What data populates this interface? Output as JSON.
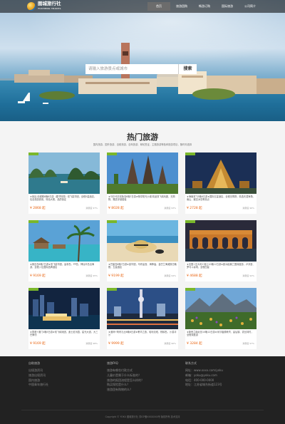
{
  "brand": {
    "name": "图城旅行社",
    "sub": "TUCHENG TRAVEL"
  },
  "nav": {
    "items": [
      "首页",
      "旅游团购",
      "畅游订购",
      "国际旅游",
      "公司简介"
    ]
  },
  "search": {
    "placeholder": "请输入旅游景点或城市",
    "button": "搜索"
  },
  "section": {
    "title": "热门旅游",
    "subtitle": "国内旅游、国外旅游、自助旅游、自驾旅游、邮轮签证、主题旅游等各种旅游项目，随时你选择"
  },
  "cards": [
    {
      "desc": "★曼谷-芭堤雅6晚8日游（春节特惠）双飞豪华团，全程5星酒店，包含旅游费用，特色大餐，品质保证",
      "price": "¥ 2868 起",
      "rate": "满意度 97%"
    },
    {
      "desc": "★马尔代夫双鱼岛6晚7日游★畅享阳光沙滩 精品双飞纯玩团，无购物，赠送浮潜套装",
      "price": "¥ 8028 起",
      "rate": "满意度 93%"
    },
    {
      "desc": "★海南双飞5晚6日游★国际五星酒店，全程无购物，精选天涯海角、南山、蜈支洲岛等景点",
      "price": "¥ 2728 起",
      "rate": "满意度 96%"
    },
    {
      "desc": "★普吉岛6晚7日游★双飞豪华团，皇帝岛、PP岛、神仙半岛出海游，全程入住国际品牌酒店",
      "price": "¥ 9169 起",
      "rate": "满意度 95%"
    },
    {
      "desc": "★巴厘岛6晚7日游★豪华团，乌布皇宫、海神庙、金巴兰海滩落日晚餐，五星酒店",
      "price": "¥ 9199 起",
      "rate": "满意度 94%"
    },
    {
      "desc": "★法国+意大利+瑞士10晚12日游★欧洲经典三国深度游，卢浮宫、罗马斗兽场，全程四星",
      "price": "¥ 4688 起",
      "rate": "满意度 92%"
    },
    {
      "desc": "★香港+澳门4晚5日游★双飞纯玩团，迪士尼乐园、星光大道、大三巴牌坊",
      "price": "¥ 9169 起",
      "rate": "满意度 98%"
    },
    {
      "desc": "★迪拜+阿布扎比6晚8日游★奢华之旅，哈利法塔、棕榈岛、沙漠冲沙",
      "price": "¥ 9999 起",
      "rate": "满意度 96%"
    },
    {
      "desc": "★新西兰南北岛10晚12日游★米尔福德峡湾、皇后镇、霍比特村，全程深度游",
      "price": "¥ 3284 起",
      "rate": "满意度 97%"
    }
  ],
  "footer": {
    "col1": {
      "title": "自助旅游",
      "links": [
        "出境游资讯",
        "旅游出境资讯",
        "国内旅游",
        "中国青年旅行社"
      ]
    },
    "col2": {
      "title": "旅游FAQ",
      "links": [
        "旅游有哪些付款方式",
        "儿童价是属于什么标准的？",
        "旅游的报团流程是怎么样的？",
        "购买保险是什么？",
        "旅游团有购物的么？"
      ]
    },
    "col3": {
      "title": "联系方式",
      "links": [
        "网址：www.xxxx.com/yoku",
        "邮箱：yoku@yoku.com",
        "电话：400-000-0000",
        "地址：江苏省城东街道123号"
      ]
    },
    "copyright": "Copyright © YOKU 图城旅行社 苏ICP备XXXXXXX号 版权所有 技术支持"
  },
  "colors": {
    "accent": "#7ab72b",
    "price": "#e8620e",
    "footer": "#222222"
  }
}
